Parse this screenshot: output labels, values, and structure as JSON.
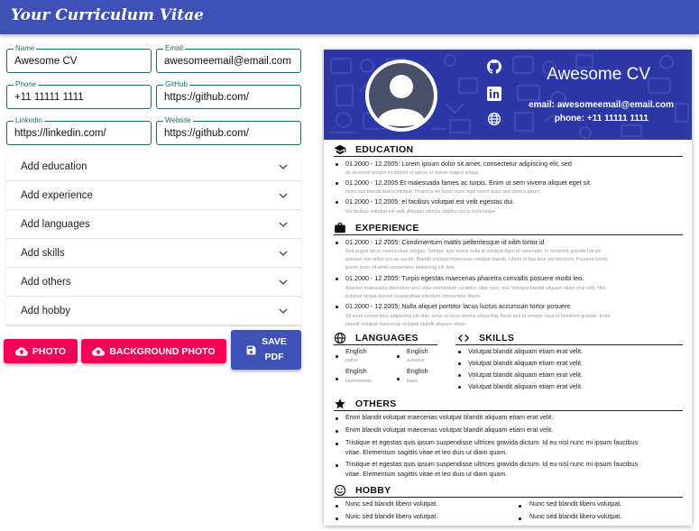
{
  "app": {
    "title": "Your Curriculum Vitae"
  },
  "form": {
    "name": {
      "label": "Name",
      "value": "Awesome CV"
    },
    "email": {
      "label": "Email",
      "value": "awesomeemail@email.com"
    },
    "phone": {
      "label": "Phone",
      "value": "+11 11111 1111"
    },
    "github": {
      "label": "GitHub",
      "value": "https://github.com/"
    },
    "linkedin": {
      "label": "Linkedin",
      "value": "https://linkedin.com/"
    },
    "website": {
      "label": "Website",
      "value": "https://github.com/"
    }
  },
  "accordions": [
    "Add education",
    "Add experience",
    "Add languages",
    "Add skills",
    "Add others",
    "Add hobby"
  ],
  "buttons": {
    "photo": "PHOTO",
    "background_photo": "BACKGROUND PHOTO",
    "save_pdf_line1": "SAVE",
    "save_pdf_line2": "PDF"
  },
  "cv": {
    "name": "Awesome CV",
    "email": "email: awesomeemail@email.com",
    "phone": "phone: +11 11111 1111",
    "education": {
      "title": "EDUCATION",
      "items": [
        {
          "text": "01.2000 - 12.2005: Lorem ipsum dolor sit amet, consectetur adipiscing elit, sed",
          "desc": "do eiusmod tempor incididunt ut labore et dolore magna aliqua."
        },
        {
          "text": "01.2000 - 12.2005:Et malesuada fames ac turpis. Enim ut sem viverra aliquet eget sit.",
          "desc": "Nunc sed blandit libero volutpat. Pharetra vel turpis nunc eget lorem dolor sed viverra ipsum."
        },
        {
          "text": "01.2000 - 12.2005: el facilisis volutpat est velit egestas dui.",
          "desc": "Vel facilisis volutpat est velit. Aliquam ultrices sagittis orci a scelerisque."
        }
      ]
    },
    "experience": {
      "title": "EXPERIENCE",
      "items": [
        {
          "text": "01.2000 - 12.2005: Condimentum mattis pellentesque id nibh tortor id",
          "desc1": "Sed augue lacus viverra vitae congue. Semper quis lectus nulla at volutpat diam ut venenatis. In hendrerit gravida rutrum",
          "desc2": "quisque non tellus orci ac auctor. Blandit volutpat maecenas volutpat blandit. Libero id faucibus nisl tincidunt. Posuere lorem",
          "desc3": "ipsum dolor sit amet consectetur adipiscing elit duis."
        },
        {
          "text": "01.2000 - 12.2005: Turpis egestas maecenas pharetra convallis posuere morbi leo.",
          "desc1": "Aliquam malesuada bibendum arcu vitae elementum curabitur vitae nunc sed. Volutpat blandit aliquam etiam erat velit. Non",
          "desc2": "pulvinar neque laoreet suspendisse interdum consectetur libero."
        },
        {
          "text": "01.2000 - 12.2005: Nulla aliquet porttitor lacus luctus accumsan tortor posuere.",
          "desc1": "Sit amet consectetur adipiscing elit duis. tortor at risus viverra adipiscing. Nunc sed id semper risus in hendrerit gravida. Enim",
          "desc2": "blandit volutpat maecenas volutpat blandit aliquam etiam."
        }
      ]
    },
    "languages": {
      "title": "LANGUAGES",
      "items": [
        {
          "name": "English",
          "level": "native"
        },
        {
          "name": "English",
          "level": "advance"
        },
        {
          "name": "English",
          "level": "intermediate"
        },
        {
          "name": "English",
          "level": "basic"
        }
      ]
    },
    "skills": {
      "title": "SKILLS",
      "items": [
        "Volutpat blandit aliquam etiam erat velit.",
        "Volutpat blandit aliquam etiam erat velit.",
        "Volutpat blandit aliquam etiam erat velit.",
        "Volutpat blandit aliquam etiam erat velit."
      ]
    },
    "others": {
      "title": "OTHERS",
      "items": [
        {
          "l1": "Enim blandit volutpat maecenas volutpat blandit aliquam etiam erat velit."
        },
        {
          "l1": "Enim blandit volutpat maecenas volutpat blandit aliquam etiam erat velit."
        },
        {
          "l1": "Tristique et egestas quis ipsum suspendisse ultrices gravida dictum. Id eu nisl nunc mi ipsum faucibus",
          "l2": "vitae. Elementum sagittis vitae et leo duis ut diam quam."
        },
        {
          "l1": "Tristique et egestas quis ipsum suspendisse ultrices gravida dictum. Id eu nisl nunc mi ipsum faucibus",
          "l2": "vitae. Elementum sagittis vitae et leo duis ut diam quam."
        }
      ]
    },
    "hobby": {
      "title": "HOBBY",
      "items": [
        "Nunc sed blandit libero volutpat.",
        "Nunc sed blandit libero volutpat.",
        "Nunc sed blandit libero volutpat.",
        "Nunc sed blandit libero volutpat."
      ]
    }
  },
  "colors": {
    "primary": "#3f51b5",
    "secondary": "#f50057",
    "field_border": "#1e6b6b",
    "cv_header": "#2d38a6"
  }
}
